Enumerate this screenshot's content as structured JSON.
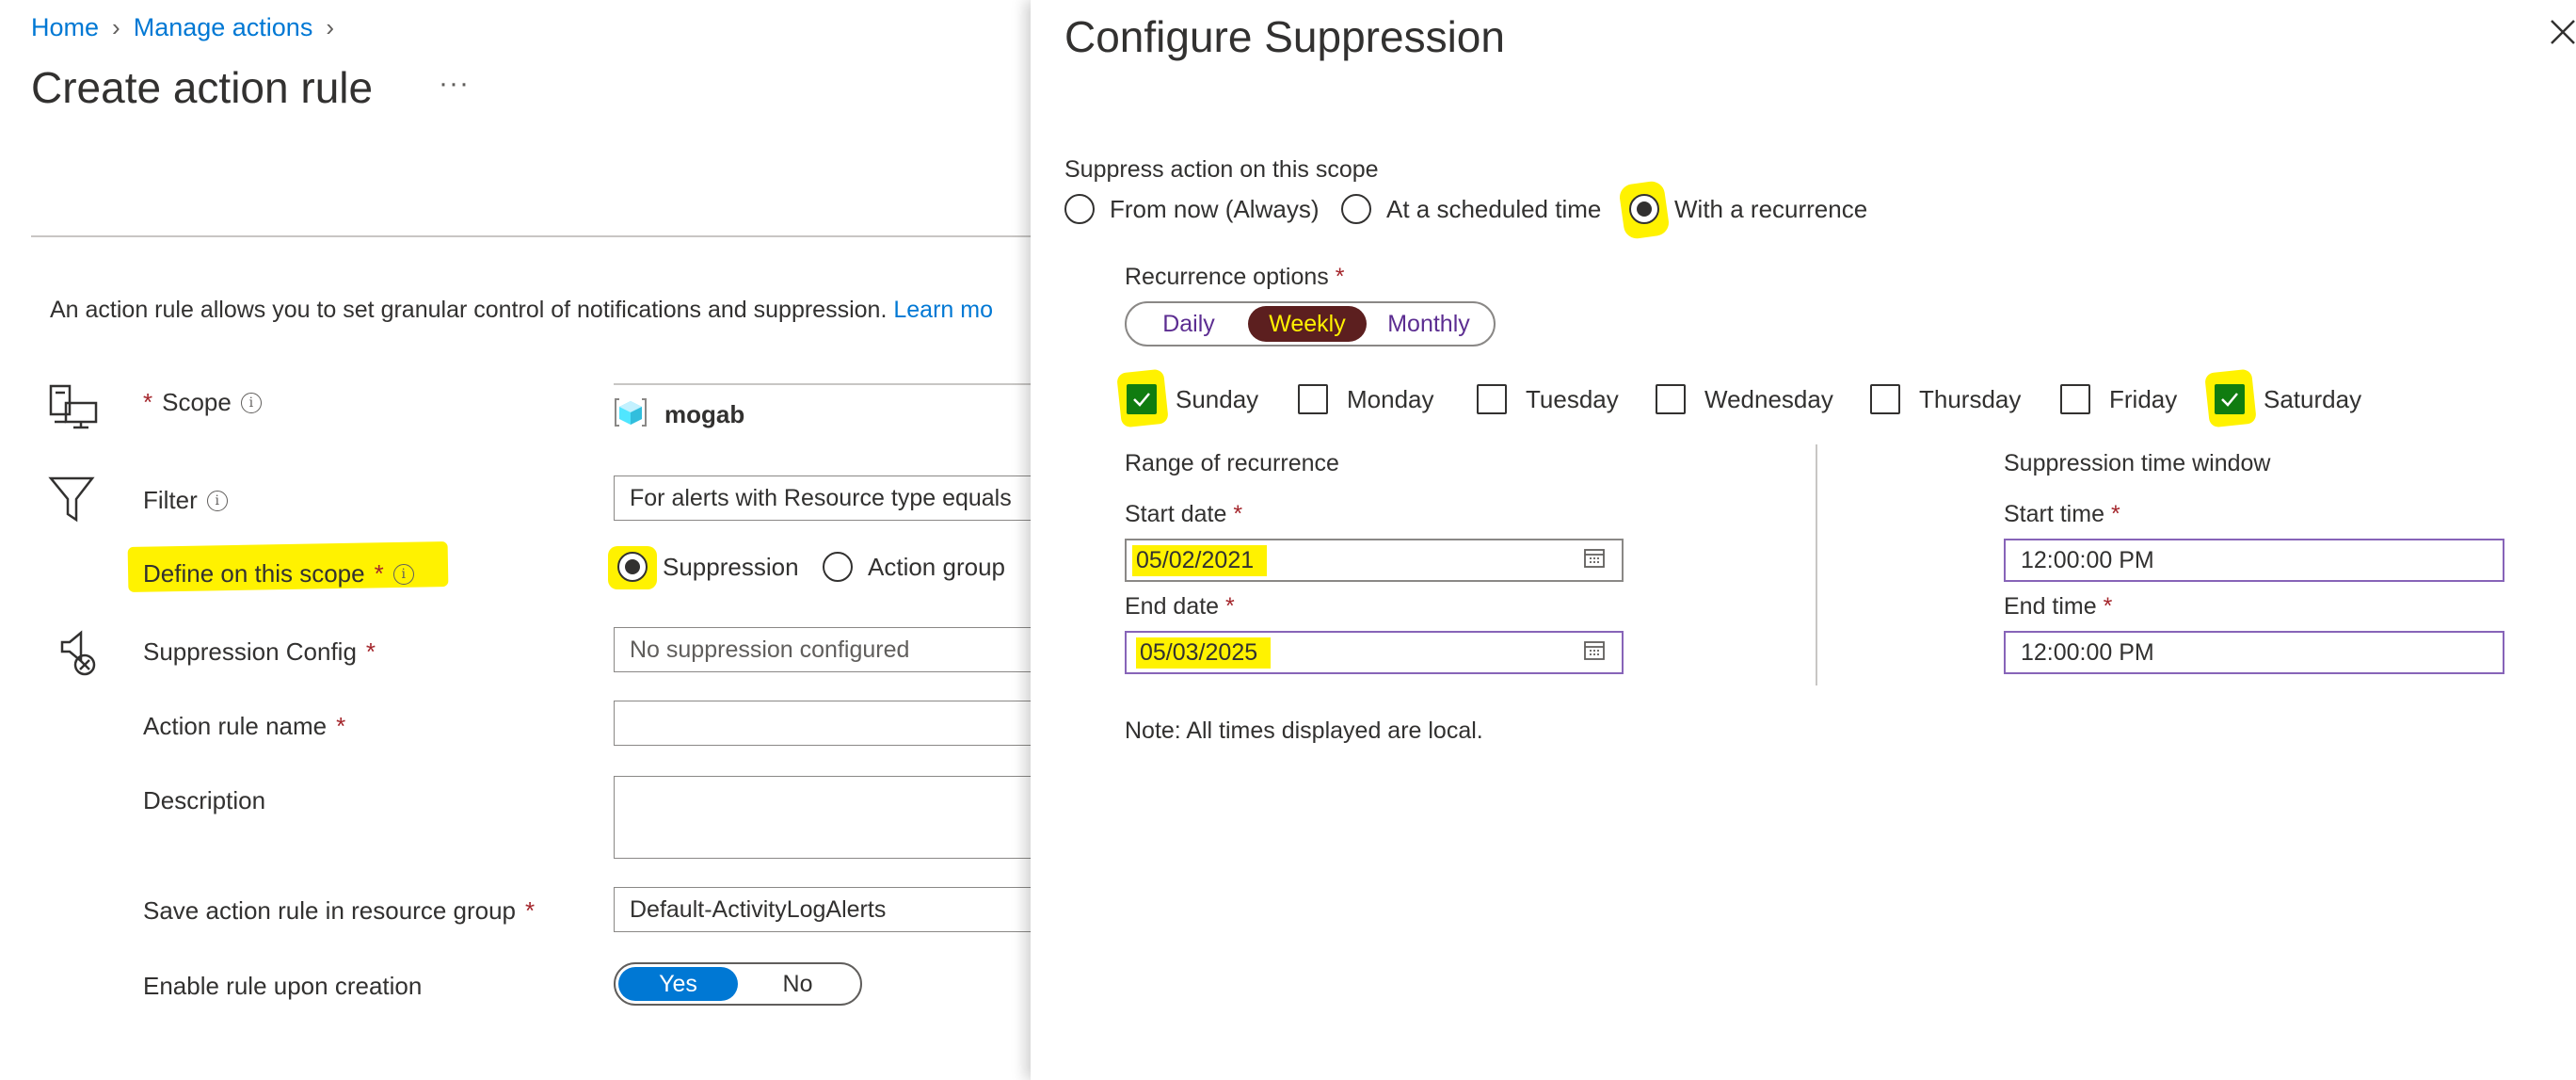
{
  "breadcrumb": {
    "home": "Home",
    "manage_actions": "Manage actions"
  },
  "page": {
    "title": "Create action rule",
    "more": "···"
  },
  "intro": {
    "text": "An action rule allows you to set granular control of notifications and suppression.",
    "link": "Learn mo"
  },
  "form": {
    "scope": {
      "label": "Scope",
      "required": "*",
      "value": "mogab"
    },
    "filter": {
      "label": "Filter",
      "value": "For alerts with Resource type equals"
    },
    "define_scope": {
      "label": "Define on this scope",
      "required": "*",
      "options": [
        "Suppression",
        "Action group"
      ],
      "selected": "Suppression"
    },
    "suppression_config": {
      "label": "Suppression Config",
      "required": "*",
      "placeholder": "No suppression configured"
    },
    "action_rule_name": {
      "label": "Action rule name",
      "required": "*",
      "value": ""
    },
    "description": {
      "label": "Description",
      "value": ""
    },
    "resource_group": {
      "label": "Save action rule in resource group",
      "required": "*",
      "value": "Default-ActivityLogAlerts"
    },
    "enable_rule": {
      "label": "Enable rule upon creation",
      "yes": "Yes",
      "no": "No",
      "selected": "Yes"
    }
  },
  "panel": {
    "title": "Configure Suppression",
    "scope_label": "Suppress action on this scope",
    "scope_options": [
      "From now (Always)",
      "At a scheduled time",
      "With a recurrence"
    ],
    "scope_selected": "With a recurrence",
    "recurrence_label": "Recurrence options",
    "required": "*",
    "recurrence_options": [
      "Daily",
      "Weekly",
      "Monthly"
    ],
    "recurrence_selected": "Weekly",
    "days": [
      {
        "label": "Sunday",
        "checked": true
      },
      {
        "label": "Monday",
        "checked": false
      },
      {
        "label": "Tuesday",
        "checked": false
      },
      {
        "label": "Wednesday",
        "checked": false
      },
      {
        "label": "Thursday",
        "checked": false
      },
      {
        "label": "Friday",
        "checked": false
      },
      {
        "label": "Saturday",
        "checked": true
      }
    ],
    "range_title": "Range of recurrence",
    "start_date_label": "Start date",
    "start_date": "05/02/2021",
    "end_date_label": "End date",
    "end_date": "05/03/2025",
    "window_title": "Suppression time window",
    "start_time_label": "Start time",
    "start_time": "12:00:00 PM",
    "end_time_label": "End time",
    "end_time": "12:00:00 PM",
    "note": "Note: All times displayed are local."
  },
  "colors": {
    "accent": "#0078d4",
    "highlight": "#fff200",
    "checked": "#107c10",
    "required": "#a4262c"
  }
}
